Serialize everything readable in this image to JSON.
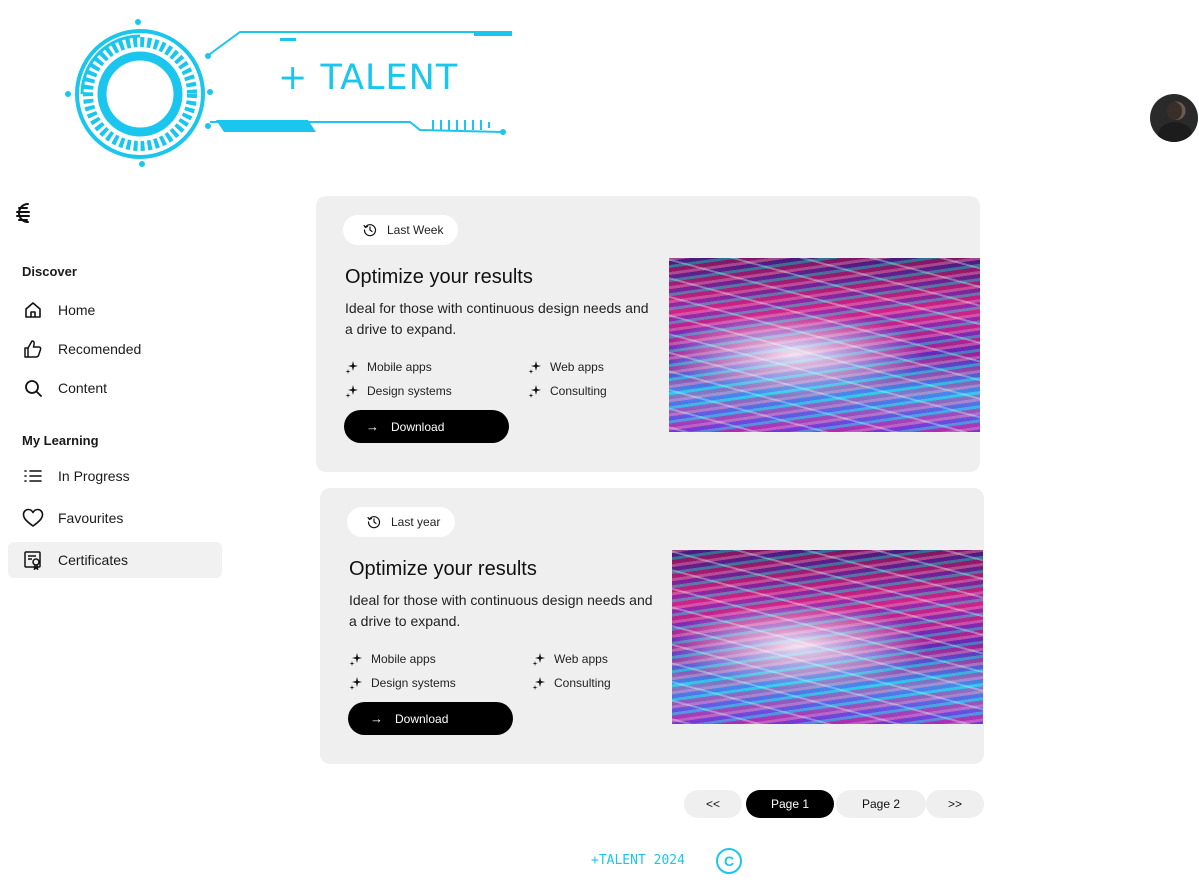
{
  "brand": {
    "logo_text": "+ TALENT",
    "accent_color": "#1bc6ee"
  },
  "header": {
    "avatar_icon": "user-avatar"
  },
  "sidebar": {
    "menu_icon": "menu-icon",
    "sections": [
      {
        "heading": "Discover",
        "items": [
          {
            "label": "Home",
            "icon": "home-icon"
          },
          {
            "label": "Recomended",
            "icon": "thumbs-up-icon"
          },
          {
            "label": "Content",
            "icon": "search-icon"
          }
        ]
      },
      {
        "heading": "My Learning",
        "items": [
          {
            "label": "In Progress",
            "icon": "list-icon"
          },
          {
            "label": "Favourites",
            "icon": "heart-icon"
          },
          {
            "label": "Certificates",
            "icon": "certificate-icon",
            "active": true
          }
        ]
      }
    ]
  },
  "cards": [
    {
      "chip": "Last Week",
      "title": "Optimize your results",
      "description": "Ideal for those with continuous design needs and a drive to expand.",
      "features": [
        "Mobile apps",
        "Web apps",
        "Design systems",
        "Consulting"
      ],
      "button": "Download"
    },
    {
      "chip": "Last year",
      "title": "Optimize your results",
      "description": "Ideal for those with continuous design needs and a drive to expand.",
      "features": [
        "Mobile apps",
        "Web apps",
        "Design systems",
        "Consulting"
      ],
      "button": "Download"
    }
  ],
  "pagination": {
    "first": "<<",
    "page1": "Page 1",
    "page2": "Page 2",
    "last": ">>",
    "current": 1
  },
  "footer": {
    "text": "+TALENT 2024",
    "copyright_symbol": "C"
  }
}
